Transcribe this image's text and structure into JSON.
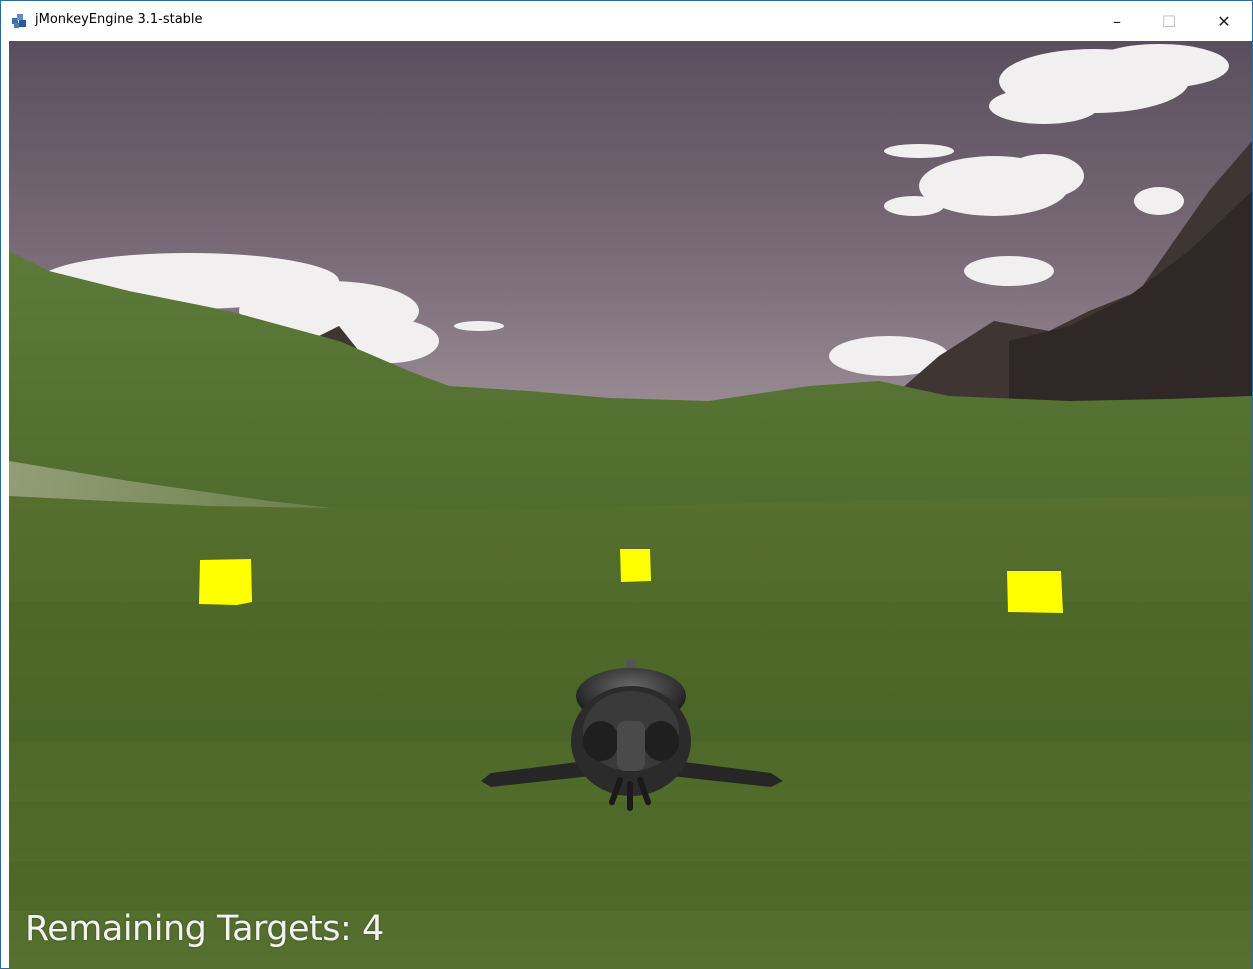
{
  "window": {
    "title": "jMonkeyEngine 3.1-stable",
    "app_icon": "jmonkey-logo-icon",
    "controls": {
      "minimize_glyph": "–",
      "maximize_glyph": "☐",
      "close_glyph": "✕"
    }
  },
  "scene": {
    "sky_color": "#6f6472",
    "ground_color": "#4e6a2a",
    "target_color": "#ffff00",
    "targets": [
      {
        "name": "left-target"
      },
      {
        "name": "center-target"
      },
      {
        "name": "right-target"
      }
    ],
    "player": "spaceship"
  },
  "hud": {
    "remaining_label": "Remaining Targets:",
    "remaining_count": "4"
  }
}
